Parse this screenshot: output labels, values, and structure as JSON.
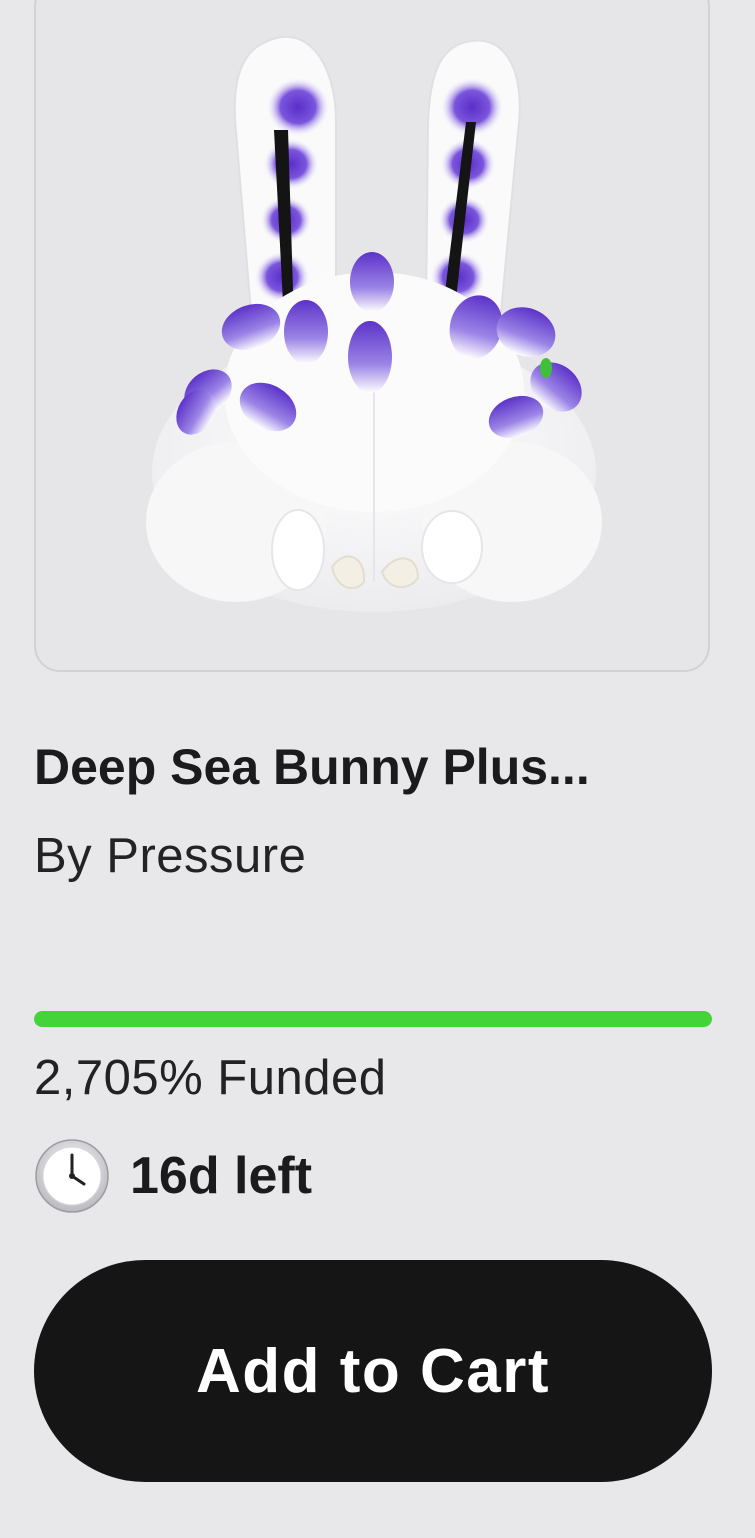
{
  "product": {
    "image_alt": "Deep Sea Bunny Plush",
    "title": "Deep Sea Bunny Plus...",
    "creator": "By Pressure"
  },
  "funding": {
    "progress_fraction": 1.0,
    "funded_percent": 2705,
    "funded_label": "2,705% Funded",
    "time_left_label": "16d left"
  },
  "icons": {
    "clock": "clock-icon"
  },
  "actions": {
    "add_to_cart_label": "Add to Cart"
  },
  "colors": {
    "background": "#e8e8eb",
    "progress_fill": "#45d33a",
    "button_bg": "#151515",
    "button_text": "#ffffff",
    "plush_accent": "#6a3fd0"
  }
}
